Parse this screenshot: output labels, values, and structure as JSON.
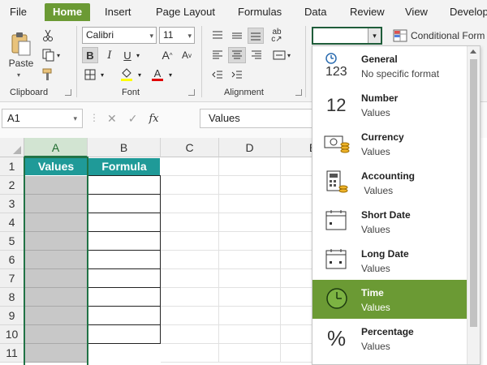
{
  "ribbon_tabs": [
    {
      "label": "File",
      "active": false
    },
    {
      "label": "Home",
      "active": true
    },
    {
      "label": "Insert",
      "active": false
    },
    {
      "label": "Page Layout",
      "active": false
    },
    {
      "label": "Formulas",
      "active": false
    },
    {
      "label": "Data",
      "active": false
    },
    {
      "label": "Review",
      "active": false
    },
    {
      "label": "View",
      "active": false
    },
    {
      "label": "Develop",
      "active": false
    }
  ],
  "clipboard": {
    "paste_label": "Paste",
    "group_label": "Clipboard"
  },
  "font": {
    "name": "Calibri",
    "size": "11",
    "bold": "B",
    "italic": "I",
    "underline": "U",
    "grow": "A",
    "shrink": "A",
    "font_color_letter": "A",
    "group_label": "Font"
  },
  "alignment": {
    "group_label": "Alignment"
  },
  "number_format": {
    "current_value": ""
  },
  "conditional_formatting": {
    "label": "Conditional Form"
  },
  "formula_bar": {
    "name_box": "A1",
    "fx": "fx",
    "formula": "Values"
  },
  "columns": [
    "A",
    "B",
    "C",
    "D",
    "E"
  ],
  "rows": [
    "1",
    "2",
    "3",
    "4",
    "5",
    "6",
    "7",
    "8",
    "9",
    "10",
    "11"
  ],
  "table": {
    "header_a": "Values",
    "header_b": "Formula"
  },
  "number_formats": [
    {
      "title": "General",
      "subtitle": "No specific format",
      "icon": "general-123-icon",
      "selected": false
    },
    {
      "title": "Number",
      "subtitle": "Values",
      "icon": "number-12-icon",
      "selected": false
    },
    {
      "title": "Currency",
      "subtitle": "Values",
      "icon": "currency-icon",
      "selected": false
    },
    {
      "title": "Accounting",
      "subtitle": " Values",
      "icon": "accounting-icon",
      "selected": false
    },
    {
      "title": "Short Date",
      "subtitle": "Values",
      "icon": "short-date-icon",
      "selected": false
    },
    {
      "title": "Long Date",
      "subtitle": "Values",
      "icon": "long-date-icon",
      "selected": false
    },
    {
      "title": "Time",
      "subtitle": "Values",
      "icon": "clock-icon",
      "selected": true
    },
    {
      "title": "Percentage",
      "subtitle": "Values",
      "icon": "percent-icon",
      "selected": false
    }
  ],
  "colors": {
    "accent": "#6b9a34",
    "header_teal": "#1f9a98",
    "selection": "#217346",
    "values_fill": "#c8c8c8"
  }
}
